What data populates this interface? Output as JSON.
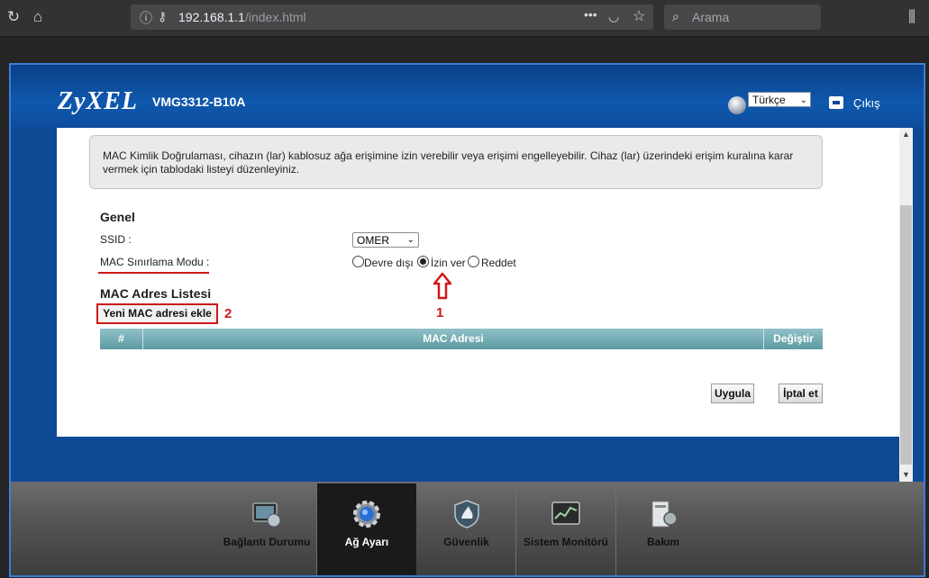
{
  "browser": {
    "url_host": "192.168.1.1",
    "url_path": "/index.html",
    "search_placeholder": "Arama",
    "icons": [
      "reload-icon",
      "home-icon",
      "info-icon",
      "key-icon",
      "more-icon",
      "pocket-icon",
      "bookmark-star-icon",
      "search-icon",
      "library-icon"
    ]
  },
  "header": {
    "brand": "ZyXEL",
    "model": "VMG3312-B10A",
    "language": "Türkçe",
    "logout_label": "Çıkış"
  },
  "info": {
    "text": "MAC Kimlik Doğrulaması, cihazın (lar) kablosuz ağa erişimine izin verebilir veya erişimi engelleyebilir. Cihaz (lar) üzerindeki erişim kuralına karar vermek için tablodaki listeyi düzenleyiniz."
  },
  "general": {
    "title": "Genel",
    "ssid_label": "SSID :",
    "ssid_value": "OMER",
    "mode_label": "MAC Sınırlama Modu :",
    "mode_options": [
      "Devre dışı",
      "İzin ver",
      "Reddet"
    ],
    "mode_selected": "İzin ver"
  },
  "mac_list": {
    "title": "MAC Adres Listesi",
    "add_button": "Yeni MAC adresi ekle",
    "columns": [
      "#",
      "MAC Adresi",
      "Değiştir"
    ],
    "rows": []
  },
  "annotations": {
    "marker_1": "1",
    "marker_2": "2",
    "color": "#d01818"
  },
  "actions": {
    "apply": "Uygula",
    "cancel": "İptal et"
  },
  "nav": {
    "items": [
      {
        "label": "Bağlantı Durumu",
        "icon": "connection-status-icon"
      },
      {
        "label": "Ağ Ayarı",
        "icon": "network-settings-gear-icon",
        "active": true
      },
      {
        "label": "Güvenlik",
        "icon": "security-shield-icon"
      },
      {
        "label": "Sistem Monitörü",
        "icon": "system-monitor-icon"
      },
      {
        "label": "Bakım",
        "icon": "maintenance-icon"
      }
    ]
  },
  "colors": {
    "header_blue": "#0d4a96",
    "table_header": "#6fa8b0",
    "frame_border": "#3b7ed8"
  }
}
